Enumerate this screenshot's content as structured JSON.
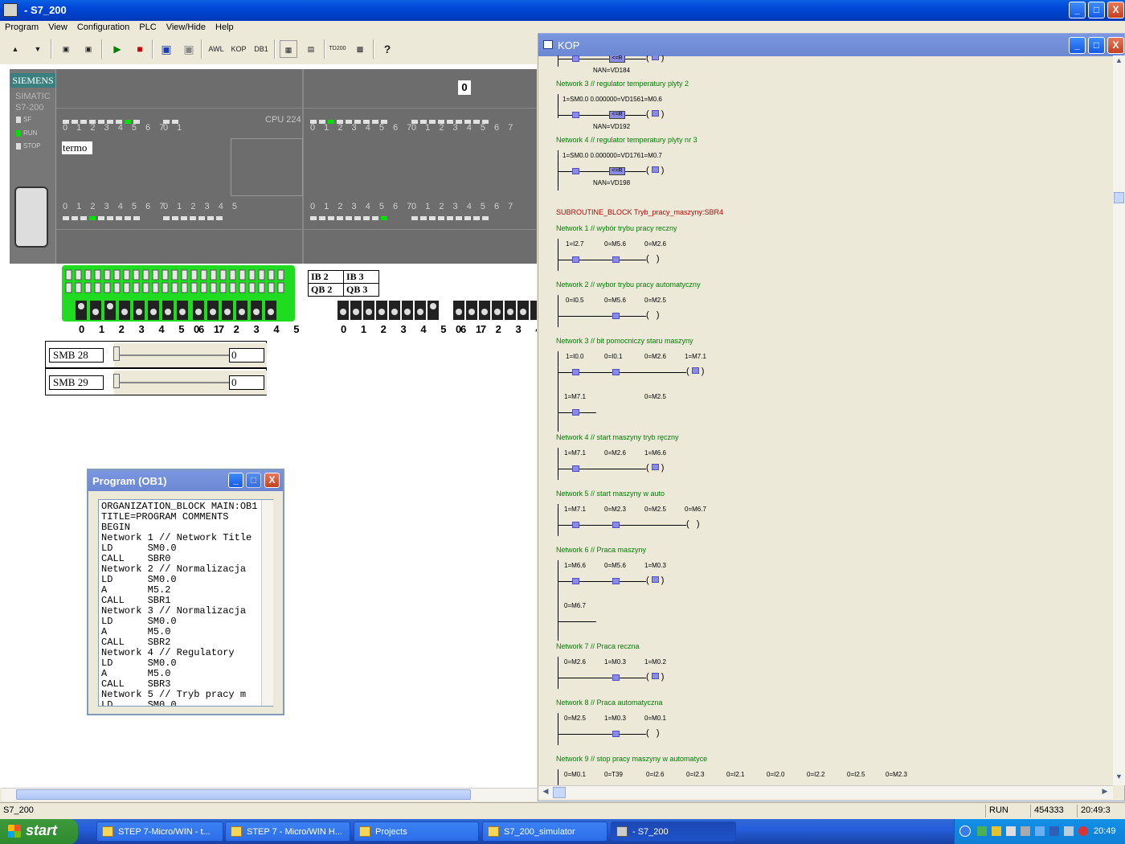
{
  "window": {
    "title": "- S7_200",
    "controls": [
      "_",
      "□",
      "X"
    ]
  },
  "menu": [
    "Program",
    "View",
    "Configuration",
    "PLC",
    "View/Hide",
    "Help"
  ],
  "toolbar": {
    "awl": "AWL",
    "kop": "KOP",
    "db1": "DB1",
    "td200": "TD200",
    "help": "?"
  },
  "plc": {
    "brand": "SIEMENS",
    "model_line1": "SIMATIC",
    "model_line2": "S7-200",
    "status": [
      "SF",
      "RUN",
      "STOP"
    ],
    "cpu": "CPU 224",
    "project_name": "termo",
    "expansion_value": "0",
    "digits8": "0 1 2 3 4 5 6 7",
    "digits2": "0 1",
    "digits6": "0 1 2 3 4 5"
  },
  "switch_numbers": {
    "bank1": "0 1 2 3 4 5 6 7",
    "bank2": "0 1 2 3 4 5",
    "bank3": "0 1 2 3 4 5 6 7",
    "bank4": "0 1 2 3 4 5 6"
  },
  "io_table": {
    "ib2": "IB 2",
    "ib3": "IB 3",
    "qb2": "QB 2",
    "qb3": "QB 3"
  },
  "smb": [
    {
      "label": "SMB 28",
      "value": "0"
    },
    {
      "label": "SMB 29",
      "value": "0"
    }
  ],
  "program_window": {
    "title": "Program (OB1)",
    "lines": "ORGANIZATION_BLOCK MAIN:OB1\nTITLE=PROGRAM COMMENTS\nBEGIN\nNetwork 1 // Network Title\nLD      SM0.0\nCALL    SBR0\nNetwork 2 // Normalizacja\nLD      SM0.0\nA       M5.2\nCALL    SBR1\nNetwork 3 // Normalizacja\nLD      SM0.0\nA       M5.0\nCALL    SBR2\nNetwork 4 // Regulatory\nLD      SM0.0\nA       M5.0\nCALL    SBR3\nNetwork 5 // Tryb pracy m\nLD      SM0.0"
  },
  "kop": {
    "title": "KOP",
    "top_nan": "NAN=VD184",
    "net3": "Network 3 // regulator temperatury plyty 2",
    "net3_line": "1=SM0.0 0.000000=VD1561=M0.6",
    "net3_nan": "NAN=VD192",
    "net4": "Network 4 // regulator temperatury plyty nr 3",
    "net4_line": "1=SM0.0 0.000000=VD1761=M0.7",
    "net4_nan": "NAN=VD198",
    "compare": "<=R",
    "subroutine": "SUBROUTINE_BLOCK Tryb_pracy_maszyny:SBR4",
    "networks": [
      {
        "title": "Network 1 // wybór trybu pracy reczny",
        "addrs": [
          "1=I2.7",
          "0=M5.6",
          "0=M2.6"
        ]
      },
      {
        "title": "Network 2 // wybor trybu pracy automatyczny",
        "addrs": [
          "0=I0.5",
          "0=M5.6",
          "0=M2.5"
        ]
      },
      {
        "title": "Network 3 // bit pomocniczy staru maszyny",
        "addrs": [
          "1=I0.0",
          "0=I0.1",
          "0=M2.6",
          "1=M7.1",
          "1=M7.1",
          "0=M2.5"
        ]
      },
      {
        "title": "Network 4 // start  maszyny tryb ręczny",
        "addrs": [
          "1=M7.1",
          "0=M2.6",
          "1=M6.6"
        ]
      },
      {
        "title": "Network 5 // start maszyny w auto",
        "addrs": [
          "1=M7.1",
          "0=M2.3",
          "0=M2.5",
          "0=M6.7"
        ]
      },
      {
        "title": "Network 6 // Praca maszyny",
        "addrs": [
          "1=M6.6",
          "0=M5.6",
          "1=M0.3",
          "0=M6.7"
        ]
      },
      {
        "title": "Network 7 // Praca reczna",
        "addrs": [
          "0=M2.6",
          "1=M0.3",
          "1=M0.2"
        ]
      },
      {
        "title": "Network 8 // Praca automatyczna",
        "addrs": [
          "0=M2.5",
          "1=M0.3",
          "0=M0.1"
        ]
      },
      {
        "title": "Network 9 // stop pracy maszyny w automatyce",
        "addrs": [
          "0=M0.1",
          "0=T39",
          "0=I2.6",
          "0=I2.3",
          "0=I2.1",
          "0=I2.0",
          "0=I2.2",
          "0=I2.5",
          "0=M2.3"
        ]
      }
    ]
  },
  "statusbar": {
    "left": "S7_200",
    "mode": "RUN",
    "counter": "454333",
    "time": "20:49:3"
  },
  "taskbar": {
    "start": "start",
    "tasks": [
      "STEP 7-Micro/WIN - t...",
      "STEP 7 - Micro/WIN H...",
      "Projects",
      "S7_200_simulator",
      "- S7_200"
    ],
    "clock": "20:49"
  },
  "colors": {
    "led_on": "#00e000",
    "switch_block": "#20dc20",
    "network_title": "#008000",
    "subroutine_title": "#c00000",
    "contact_fill": "#8a8ae8"
  }
}
